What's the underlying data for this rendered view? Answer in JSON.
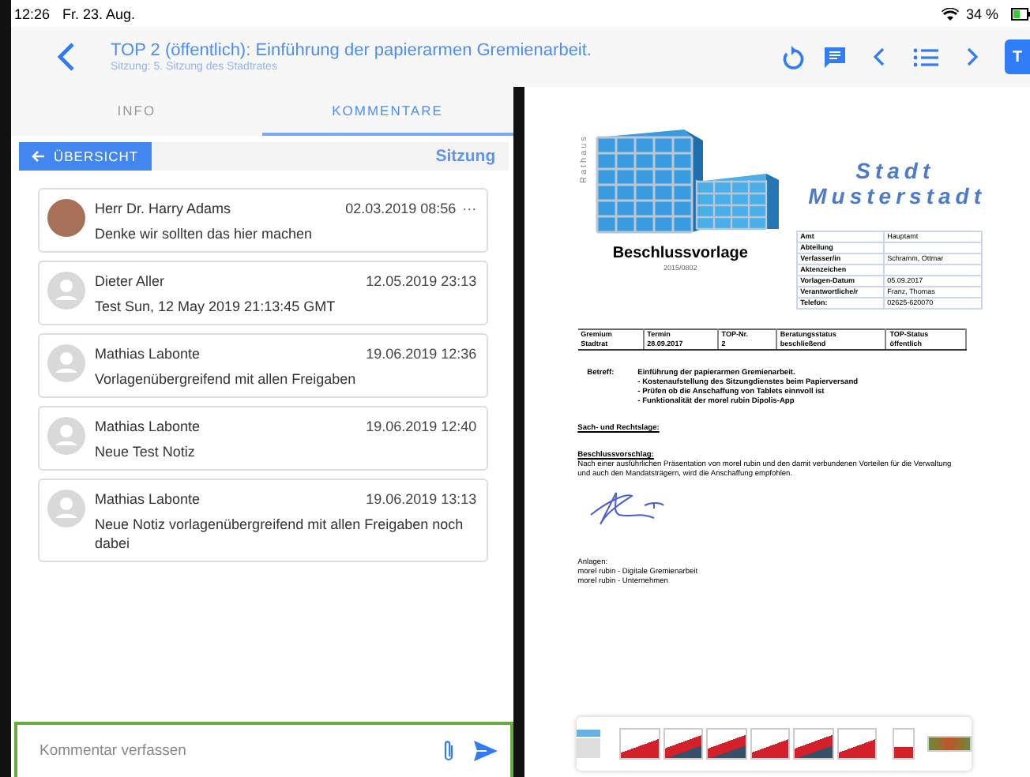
{
  "status_bar": {
    "time": "12:26",
    "date": "Fr. 23. Aug.",
    "battery": "34 %"
  },
  "header": {
    "title": "TOP 2 (öffentlich): Einführung der papierarmen Gremienarbeit.",
    "subtitle": "Sitzung: 5. Sitzung des Stadtrates",
    "folder_label": "T"
  },
  "tabs": [
    {
      "label": "INFO",
      "selected": false
    },
    {
      "label": "KOMMENTARE",
      "selected": true
    }
  ],
  "toolbar": {
    "back_button": "ÜBERSICHT",
    "link": "Sitzung"
  },
  "comments": [
    {
      "kind": "photo",
      "author": "Herr Dr. Harry Adams",
      "date": "02.03.2019 08:56",
      "text": "Denke wir sollten das hier machen",
      "menu": "···"
    },
    {
      "kind": "default",
      "author": "Dieter Aller",
      "date": "12.05.2019 23:13",
      "text": "Test Sun, 12 May 2019 21:13:45 GMT"
    },
    {
      "kind": "default",
      "author": "Mathias Labonte",
      "date": "19.06.2019 12:36",
      "text": "Vorlagenübergreifend mit allen Freigaben"
    },
    {
      "kind": "default",
      "author": "Mathias Labonte",
      "date": "19.06.2019 12:40",
      "text": "Neue Test Notiz"
    },
    {
      "kind": "default",
      "author": "Mathias Labonte",
      "date": "19.06.2019 13:13",
      "text": "Neue Notiz vorlagenübergreifend mit allen Freigaben noch dabei"
    }
  ],
  "composer": {
    "placeholder": "Kommentar verfassen"
  },
  "document": {
    "logo_text": "Rathaus",
    "city": [
      "Stadt",
      "Musterstadt"
    ],
    "doc_type": "Beschlussvorlage",
    "doc_number": "2015/0802",
    "info": [
      {
        "label": "Amt",
        "value": "Hauptamt"
      },
      {
        "label": "Abteilung"
      },
      {
        "label": "Verfasser/in",
        "value": "Schramm, Ottmar"
      },
      {
        "label": "Aktenzeichen"
      },
      {
        "label": "Vorlagen-Datum",
        "value": "05.09.2017"
      },
      {
        "label": "Verantwortliche/r",
        "value": "Franz, Thomas"
      },
      {
        "label": "Telefon:",
        "value": "02625-620070"
      }
    ],
    "session_table": {
      "columns": [
        "Gremium",
        "Termin",
        "TOP-Nr.",
        "Beratungsstatus",
        "TOP-Status"
      ],
      "rows": [
        [
          "Stadtrat",
          "28.09.2017",
          "2",
          "beschließend",
          "öffentlich"
        ]
      ]
    },
    "subject_label": "Betreff:",
    "subject_lines": [
      "Einführung der papierarmen Gremienarbeit.",
      "- Kostenaufstellung des Sitzungdienstes beim Papierversand",
      "- Prüfen ob die Anschaffung von Tablets einnvoll ist",
      "- Funktionalität der morel rubin Dipolis-App"
    ],
    "sections": [
      {
        "heading": "Sach- und Rechtslage:"
      },
      {
        "heading": "Beschlussvorschlag:",
        "text": "Nach einer ausführlichen Präsentation von morel rubin und den damit verbundenen Vorteilen für die Verwaltung und auch den Mandatsträgern, wird die Anschaffung empfohlen."
      }
    ],
    "attachments_label": "Anlagen:",
    "attachments": [
      "morel rubin - Digitale Gremienarbeit",
      "morel rubin - Unternehmen"
    ]
  }
}
